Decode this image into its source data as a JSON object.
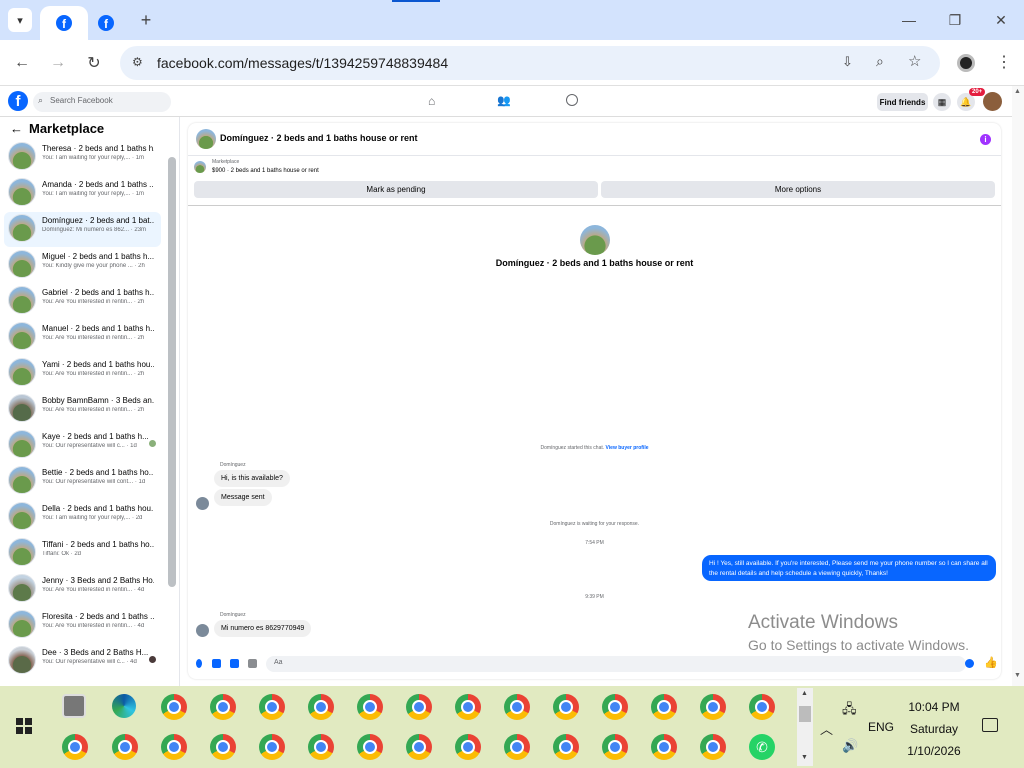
{
  "browser": {
    "url": "facebook.com/messages/t/1394259748839484"
  },
  "fb_header": {
    "search_placeholder": "Search Facebook",
    "find_friends": "Find friends",
    "notif_badge": "20+"
  },
  "sidebar": {
    "title": "Marketplace",
    "conversations": [
      {
        "name": "Theresa · 2 beds and 1 baths h...",
        "preview": "You: I am waiting for your reply,... · 1m"
      },
      {
        "name": "Amanda · 2 beds and 1 baths ...",
        "preview": "You: I am waiting for your reply,... · 1m"
      },
      {
        "name": "Domínguez · 2 beds and 1 bat...",
        "preview": "Domínguez: Mi numero es 862... · 23m"
      },
      {
        "name": "Miguel · 2 beds and 1 baths h...",
        "preview": "You: Kindly give me your phone ... · 2h"
      },
      {
        "name": "Gabriel · 2 beds and 1 baths h...",
        "preview": "You: Are You interested in rentin... · 2h"
      },
      {
        "name": "Manuel · 2 beds and 1 baths h...",
        "preview": "You: Are You interested in rentin... · 2h"
      },
      {
        "name": "Yami · 2 beds and 1 baths hou...",
        "preview": "You: Are You interested in rentin... · 2h"
      },
      {
        "name": "Bobby BamnBamn · 3 Beds an...",
        "preview": "You: Are You interested in rentin... · 2h"
      },
      {
        "name": "Kaye · 2 beds and 1 baths h...",
        "preview": "You: Our representative will c... · 1d"
      },
      {
        "name": "Bettie · 2 beds and 1 baths ho...",
        "preview": "You: Our representative will cont... · 1d"
      },
      {
        "name": "Della · 2 beds and 1 baths hou...",
        "preview": "You: I am waiting for your reply,... · 2d"
      },
      {
        "name": "Tiffani · 2 beds and 1 baths ho...",
        "preview": "Tiffani: Ok · 2d"
      },
      {
        "name": "Jenny · 3 Beds and 2 Baths Ho...",
        "preview": "You: Are You interested in rentin... · 4d"
      },
      {
        "name": "Floresita · 2 beds and 1 baths ...",
        "preview": "You: Are You interested in rentin... · 4d"
      },
      {
        "name": "Dee · 3 Beds and 2 Baths H...",
        "preview": "You: Our representative will c... · 4d"
      }
    ]
  },
  "chat": {
    "title": "Domínguez · 2 beds and 1 baths house or rent",
    "marketplace_label": "Marketplace",
    "listing": "$900 · 2 beds and 1 baths house or rent",
    "mark_pending": "Mark as pending",
    "more_options": "More options",
    "profile_name": "Domínguez · 2 beds and 1 baths house or rent",
    "started_text": "Domínguez started this chat.",
    "view_profile": "View buyer profile",
    "sender1": "Domínguez",
    "msg1": "Hi, is this available?",
    "msg2": "Message sent",
    "waiting": "Domínguez is waiting for your response.",
    "time1": "7:54 PM",
    "out_msg": "Hi ! Yes, still available. If you're interested, Please send me your phone number so I can share all the rental details and help schedule a viewing quickly, Thanks!",
    "time2": "9:39 PM",
    "sender2": "Domínguez",
    "msg3": "Mi numero es 8629770949",
    "composer_placeholder": "Aa"
  },
  "watermark": {
    "line1": "Activate Windows",
    "line2": "Go to Settings to activate Windows."
  },
  "taskbar": {
    "lang": "ENG",
    "time": "10:04 PM",
    "day": "Saturday",
    "date": "1/10/2026"
  },
  "colors": {
    "fb_blue": "#0866ff",
    "taskbar": "#e1eac1",
    "tabstrip": "#d3e3fd"
  }
}
